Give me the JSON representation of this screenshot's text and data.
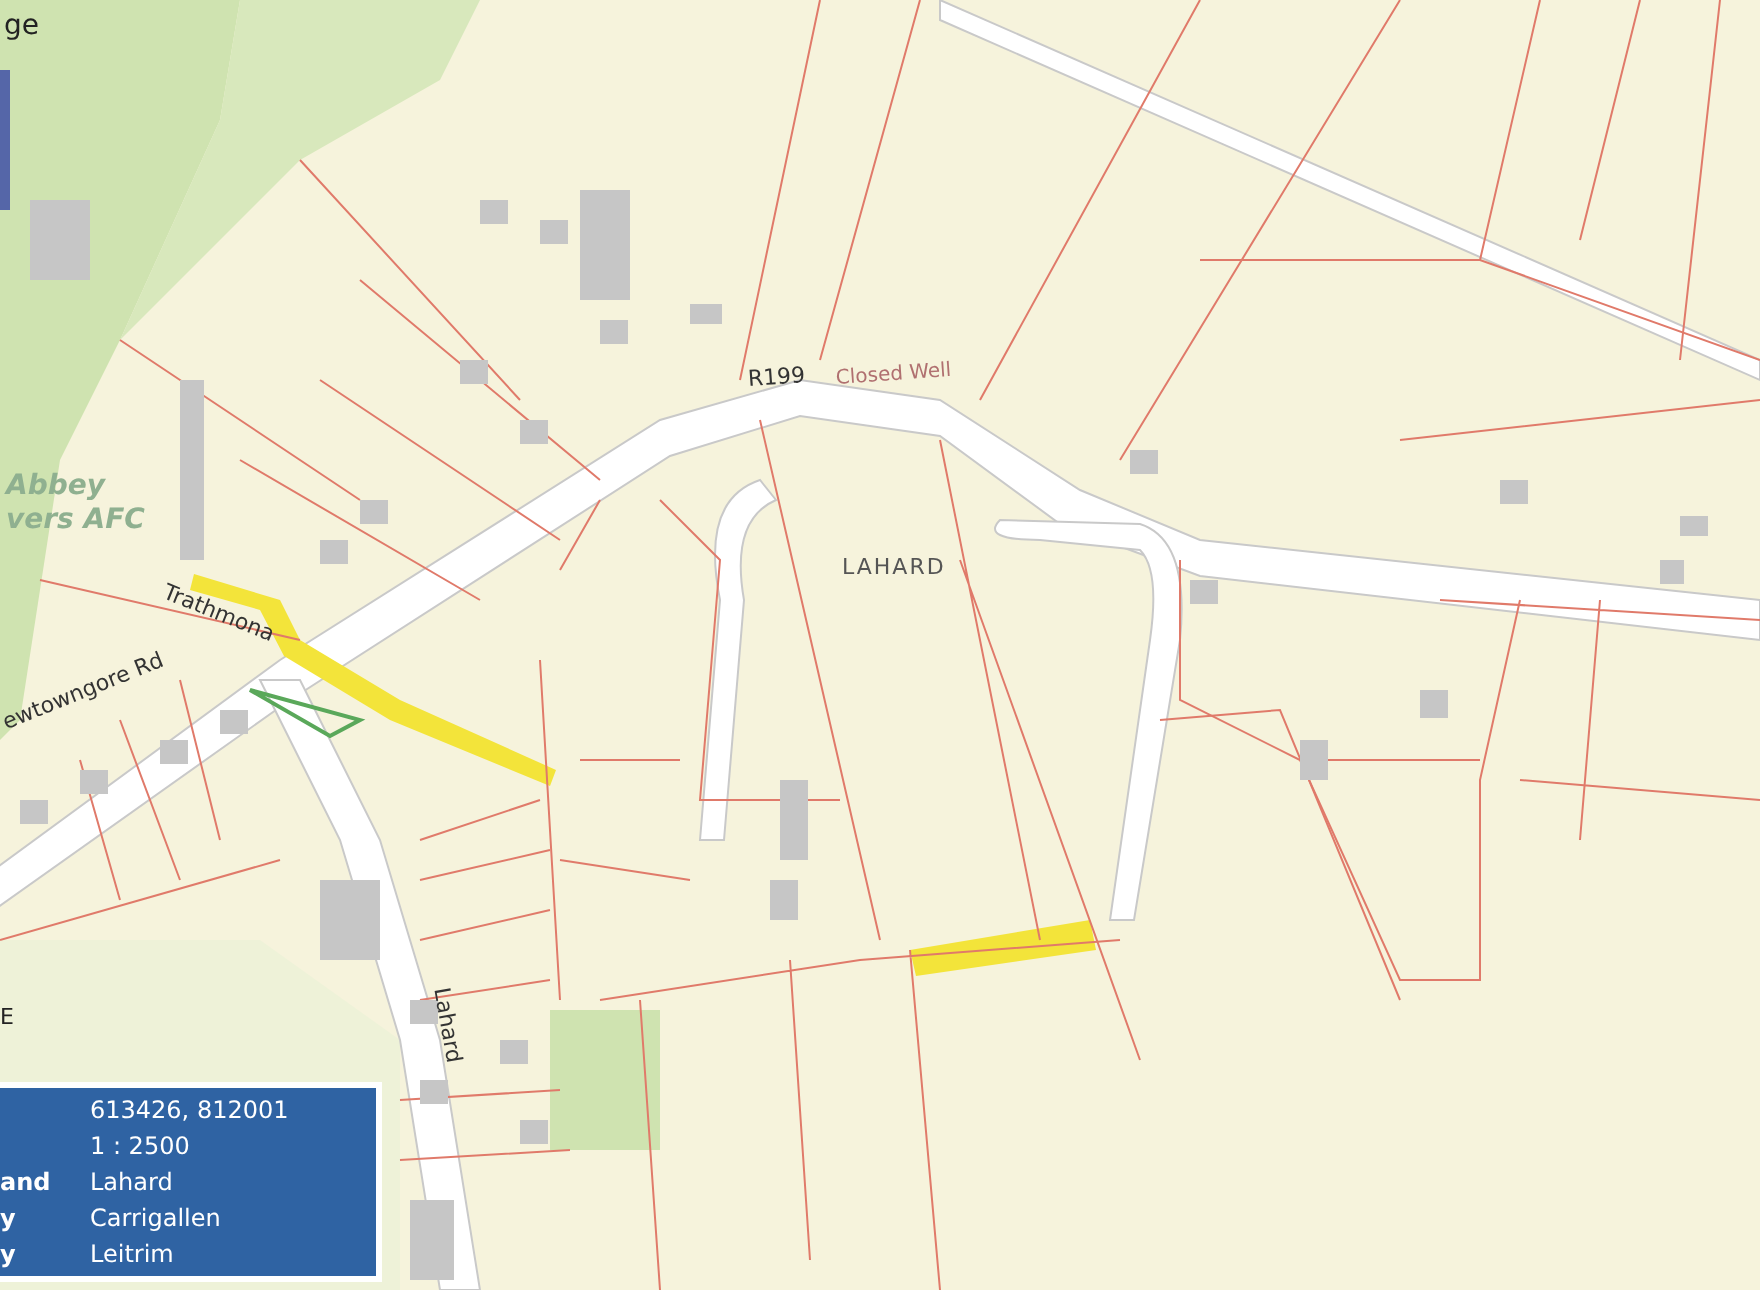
{
  "map": {
    "labels": [
      {
        "kind": "page",
        "text": "ge"
      },
      {
        "kind": "road",
        "text": "R199"
      },
      {
        "kind": "poi",
        "text": "Closed Well"
      },
      {
        "kind": "townland",
        "text": "LAHARD"
      },
      {
        "kind": "park",
        "text": "Abbey"
      },
      {
        "kind": "park",
        "text": "vers AFC"
      },
      {
        "kind": "road",
        "text": "Trathmona"
      },
      {
        "kind": "road",
        "text": "ewtowngore Rd"
      },
      {
        "kind": "road",
        "text": "Lahard"
      },
      {
        "kind": "page",
        "text": "E"
      }
    ]
  },
  "info_panel": {
    "rows": [
      {
        "value": "613426, 812001"
      },
      {
        "value": "1 : 2500"
      },
      {
        "label": "and",
        "value": "Lahard"
      },
      {
        "label": "y",
        "value": "Carrigallen"
      },
      {
        "label": "y",
        "value": "Leitrim"
      }
    ]
  }
}
